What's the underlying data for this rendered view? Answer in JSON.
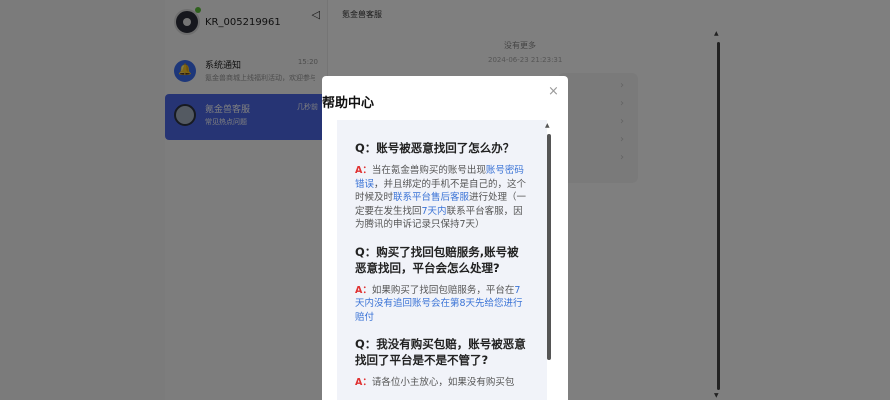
{
  "account": {
    "username": "KR_005219961"
  },
  "conversations": [
    {
      "title": "系统通知",
      "time": "15:20",
      "preview": "氪金兽商城上线福利活动，欢迎参与"
    },
    {
      "title": "氪金兽客服",
      "time": "几秒前",
      "preview": "常见热点问题"
    }
  ],
  "chat": {
    "header": "氪金兽客服",
    "no_more": "没有更多",
    "timestamp": "2024-06-23 21:23:31"
  },
  "modal": {
    "title": "帮助中心",
    "close_icon": "close-icon",
    "qa": [
      {
        "q": "Q：账号被恶意找回了怎么办？",
        "a_prefix": "A：",
        "a_parts": [
          "当在氪金兽购买的账号出现",
          "账号密码错误",
          "，并且绑定的手机不是自己的，这个时候及时",
          "联系平台售后客服",
          "进行处理（一定要在发生找回",
          "7天内",
          "联系平台客服，因为腾讯的申诉记录只保持7天）"
        ]
      },
      {
        "q": "Q：购买了找回包赔服务,账号被恶意找回，平台会怎么处理?",
        "a_prefix": "A：",
        "a_parts": [
          "如果购买了找回包赔服务，平台在",
          "7天内没有追回账号会在第8天先给您进行赔付",
          ""
        ]
      },
      {
        "q": "Q：我没有购买包赔，账号被恶意找回了平台是不是不管了?",
        "a_prefix": "A：",
        "a_parts": [
          "请各位小主放心，如果没有购买包",
          "",
          ""
        ]
      }
    ]
  },
  "colors": {
    "accent": "#4d68e8",
    "highlight_link": "#3a73d6",
    "answer_prefix": "#e03131"
  }
}
